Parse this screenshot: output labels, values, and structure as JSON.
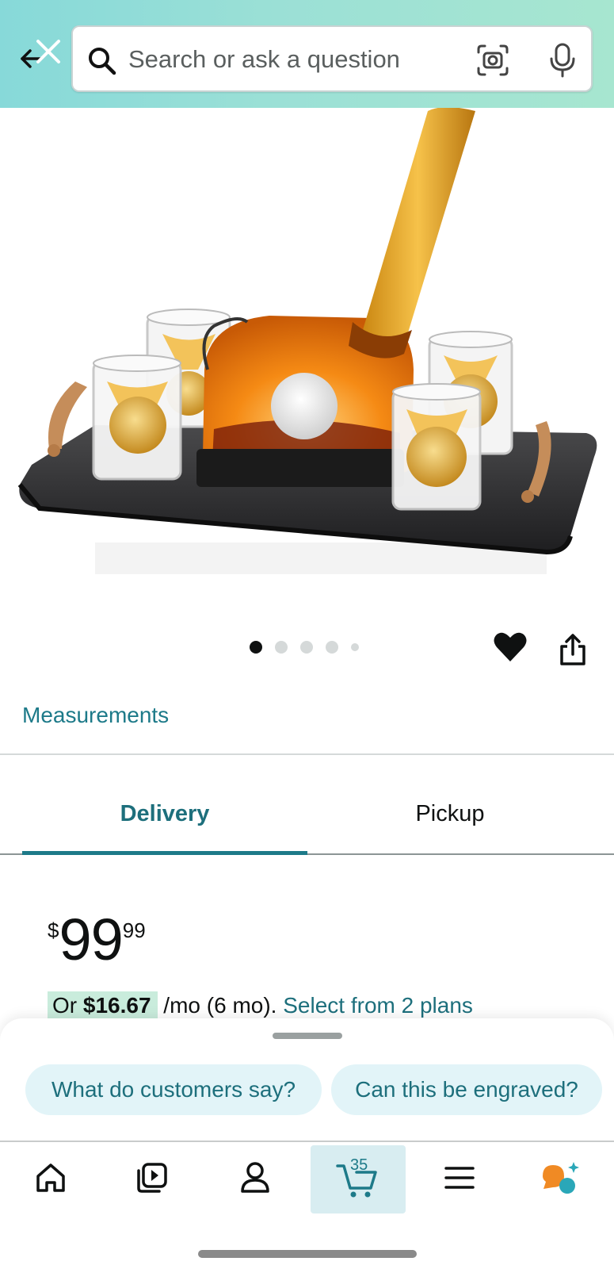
{
  "header": {
    "search_placeholder": "Search or ask a question",
    "icons": [
      "back-arrow-icon",
      "close-icon",
      "search-icon",
      "camera-lens-icon",
      "microphone-icon"
    ]
  },
  "product": {
    "image_indicator": {
      "count": 5,
      "active_index": 0
    },
    "actions": [
      "heart-icon",
      "share-icon"
    ]
  },
  "links": {
    "measurements": "Measurements"
  },
  "tabs": [
    {
      "label": "Delivery",
      "active": true
    },
    {
      "label": "Pickup",
      "active": false
    }
  ],
  "price": {
    "symbol": "$",
    "whole": "99",
    "fraction": "99"
  },
  "installment": {
    "prefix": "Or ",
    "amount": "$16.67",
    "term": " /mo (6 mo). ",
    "link": "Select from 2 plans"
  },
  "suggestions": [
    "What do customers say?",
    "Can this be engraved?"
  ],
  "nav": {
    "items": [
      "home-icon",
      "video-icon",
      "account-icon",
      "cart-icon",
      "menu-icon",
      "rufus-icon"
    ],
    "cart_count": "35"
  },
  "colors": {
    "accent": "#1d7a89",
    "header_gradient_start": "#87d9d9",
    "header_gradient_end": "#a7e6d0",
    "installment_badge": "#c9ecdc",
    "chip_bg": "#e2f4f8",
    "rufus_orange": "#f08a24",
    "rufus_teal": "#2aa7b8"
  }
}
